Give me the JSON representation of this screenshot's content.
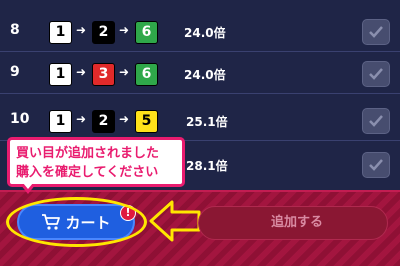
{
  "rows": [
    {
      "rank": "8",
      "boats": [
        {
          "num": "1",
          "bg": "#ffffff",
          "fg": "#000000"
        },
        {
          "num": "2",
          "bg": "#000000",
          "fg": "#ffffff"
        },
        {
          "num": "6",
          "bg": "#2fa84a",
          "fg": "#ffffff"
        }
      ],
      "odds": "24.0倍"
    },
    {
      "rank": "9",
      "boats": [
        {
          "num": "1",
          "bg": "#ffffff",
          "fg": "#000000"
        },
        {
          "num": "3",
          "bg": "#e02a2a",
          "fg": "#ffffff"
        },
        {
          "num": "6",
          "bg": "#2fa84a",
          "fg": "#ffffff"
        }
      ],
      "odds": "24.0倍"
    },
    {
      "rank": "10",
      "boats": [
        {
          "num": "1",
          "bg": "#ffffff",
          "fg": "#000000"
        },
        {
          "num": "2",
          "bg": "#000000",
          "fg": "#ffffff"
        },
        {
          "num": "5",
          "bg": "#ffe21a",
          "fg": "#000000"
        }
      ],
      "odds": "25.1倍"
    },
    {
      "rank": "",
      "boats": [],
      "odds": "28.1倍"
    }
  ],
  "arrow_glyph": "➜",
  "tooltip": {
    "line1": "買い目が追加されました",
    "line2": "購入を確定してください"
  },
  "cart_button": {
    "label": "カート",
    "badge": "!"
  },
  "add_button": {
    "label": "追加する"
  },
  "colors": {
    "background": "#1f2547",
    "action_bar": "#a3153f",
    "cart_blue": "#1f5fe0",
    "highlight_yellow": "#ffe600",
    "tooltip_pink": "#e91c6f"
  }
}
